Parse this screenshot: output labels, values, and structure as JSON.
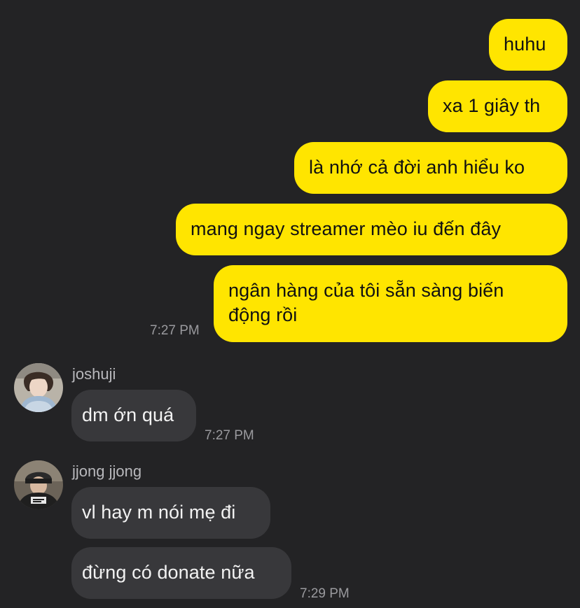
{
  "colors": {
    "background": "#232325",
    "outgoing_bubble": "#FFE500",
    "incoming_bubble": "#38383B",
    "timestamp": "#9A9A9E"
  },
  "outgoing": {
    "messages": [
      "huhu",
      "xa 1 giây th",
      "là nhớ cả đời anh hiểu ko",
      "mang ngay streamer mèo iu đến đây",
      "ngân hàng của tôi sẵn sàng biến\nđộng rồi"
    ],
    "time": "7:27 PM"
  },
  "incoming": [
    {
      "sender": "joshuji",
      "avatar": "user-avatar",
      "messages": [
        "dm ớn quá"
      ],
      "time": "7:27 PM"
    },
    {
      "sender": "jjong jjong",
      "avatar": "user-avatar",
      "messages": [
        "vl hay m nói mẹ đi",
        "đừng có donate nữa"
      ],
      "time": "7:29 PM"
    }
  ]
}
